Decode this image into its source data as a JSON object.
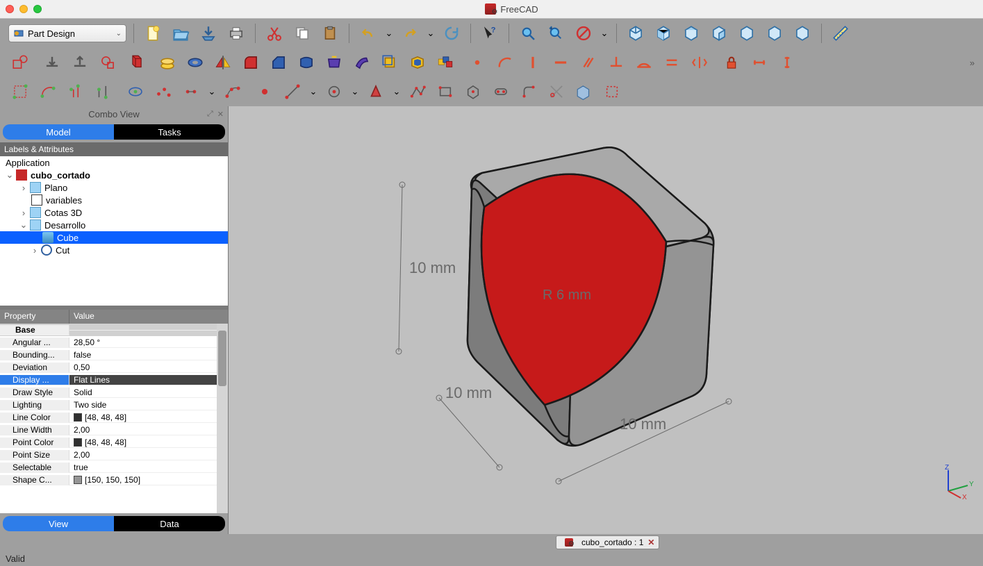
{
  "app": {
    "title": "FreeCAD"
  },
  "titlebar": {
    "close_label": "close",
    "min_label": "minimize",
    "max_label": "maximize"
  },
  "workbench": {
    "label": "Part Design"
  },
  "combo": {
    "title": "Combo View",
    "tab_model": "Model",
    "tab_tasks": "Tasks",
    "panel_header": "Labels & Attributes",
    "root": "Application",
    "props_col1": "Property",
    "props_col2": "Value"
  },
  "tree": {
    "doc": "cubo_cortado",
    "n1": "Plano",
    "n2": "variables",
    "n3": "Cotas 3D",
    "n4": "Desarrollo",
    "n5": "Cube",
    "n6": "Cut"
  },
  "props": {
    "group": "Base",
    "r1k": "Angular ...",
    "r1v": "28,50 °",
    "r2k": "Bounding...",
    "r2v": "false",
    "r3k": "Deviation",
    "r3v": "0,50",
    "r4k": "Display ...",
    "r4v": "Flat Lines",
    "r5k": "Draw Style",
    "r5v": "Solid",
    "r6k": "Lighting",
    "r6v": "Two side",
    "r7k": "Line Color",
    "r7v": "[48, 48, 48]",
    "r8k": "Line Width",
    "r8v": "2,00",
    "r9k": "Point Color",
    "r9v": "[48, 48, 48]",
    "r10k": "Point Size",
    "r10v": "2,00",
    "r11k": "Selectable",
    "r11v": "true",
    "r12k": "Shape C...",
    "r12v": "[150, 150, 150]"
  },
  "bottom_tabs": {
    "view": "View",
    "data": "Data"
  },
  "doc_tab": {
    "label": "cubo_cortado : 1"
  },
  "status": {
    "text": "Valid"
  },
  "dims": {
    "d1": "10 mm",
    "d2": "10 mm",
    "d3": "10 mm",
    "r": "R 6 mm"
  },
  "gizmo": {
    "x": "X",
    "y": "Y",
    "z": "Z"
  }
}
